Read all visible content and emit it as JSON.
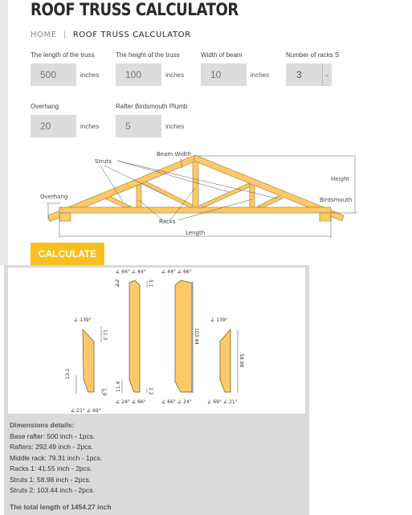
{
  "page": {
    "title": "ROOF TRUSS CALCULATOR"
  },
  "breadcrumb": {
    "home": "HOME",
    "current": "ROOF TRUSS CALCULATOR"
  },
  "form": {
    "length": {
      "label": "The length of the truss",
      "value": "500",
      "unit": "inches"
    },
    "height": {
      "label": "The height of the truss",
      "value": "100",
      "unit": "inches"
    },
    "beam_width": {
      "label": "Width of beam",
      "value": "10",
      "unit": "inches"
    },
    "racks": {
      "label": "Number of racks S",
      "value": "3"
    },
    "overhang": {
      "label": "Overhang",
      "value": "20",
      "unit": "inches"
    },
    "birdsmouth": {
      "label": "Rafter Birdsmouth Plumb",
      "value": "5",
      "unit": "inches"
    },
    "calculate_label": "CALCULATE"
  },
  "diagram": {
    "beam_width": "Beam Width",
    "struts": "Struts",
    "height": "Height",
    "birdsmouth": "Birdsmouth",
    "overhang": "Overhang",
    "racks": "Racks",
    "length": "Length"
  },
  "pieces": {
    "p1": {
      "top_angle": "∠ 139°",
      "dim_top": "11.3",
      "dim_bl": "13.2",
      "dim_br": "1.9",
      "bottom": "∠ 21°  ∠ 69°"
    },
    "p2": {
      "top": "∠ 66°  ∠ 44°",
      "dim_tl": "2.2",
      "dim_tr": "5.1",
      "dim_bl": "11.4",
      "dim_br": "2.2",
      "bottom": "∠ 24°  ∠ 66°"
    },
    "p3": {
      "top": "∠ 44°  ∠ 66°",
      "dim": "103.44",
      "bottom": "∠ 66°  ∠ 24°"
    },
    "p4": {
      "top_angle": "∠ 139°",
      "dim": "58.98",
      "bottom": "∠ 69°  ∠ 21°"
    }
  },
  "results": {
    "heading": "Dimensions details:",
    "lines": [
      "Base rafter: 500 inch - 1pcs.",
      "Rafters: 292.49 inch - 2pcs.",
      "Middle rack: 79.31 inch - 1pcs.",
      "Racks 1: 41.55 inch - 2pcs.",
      "Struts 1: 58.98 inch - 2pcs.",
      "Struts 2: 103.44 inch - 2pcs."
    ],
    "total": "The total length of 1454.27 inch"
  },
  "colors": {
    "accent": "#f9bf1f",
    "wood": "#fcc96a"
  }
}
